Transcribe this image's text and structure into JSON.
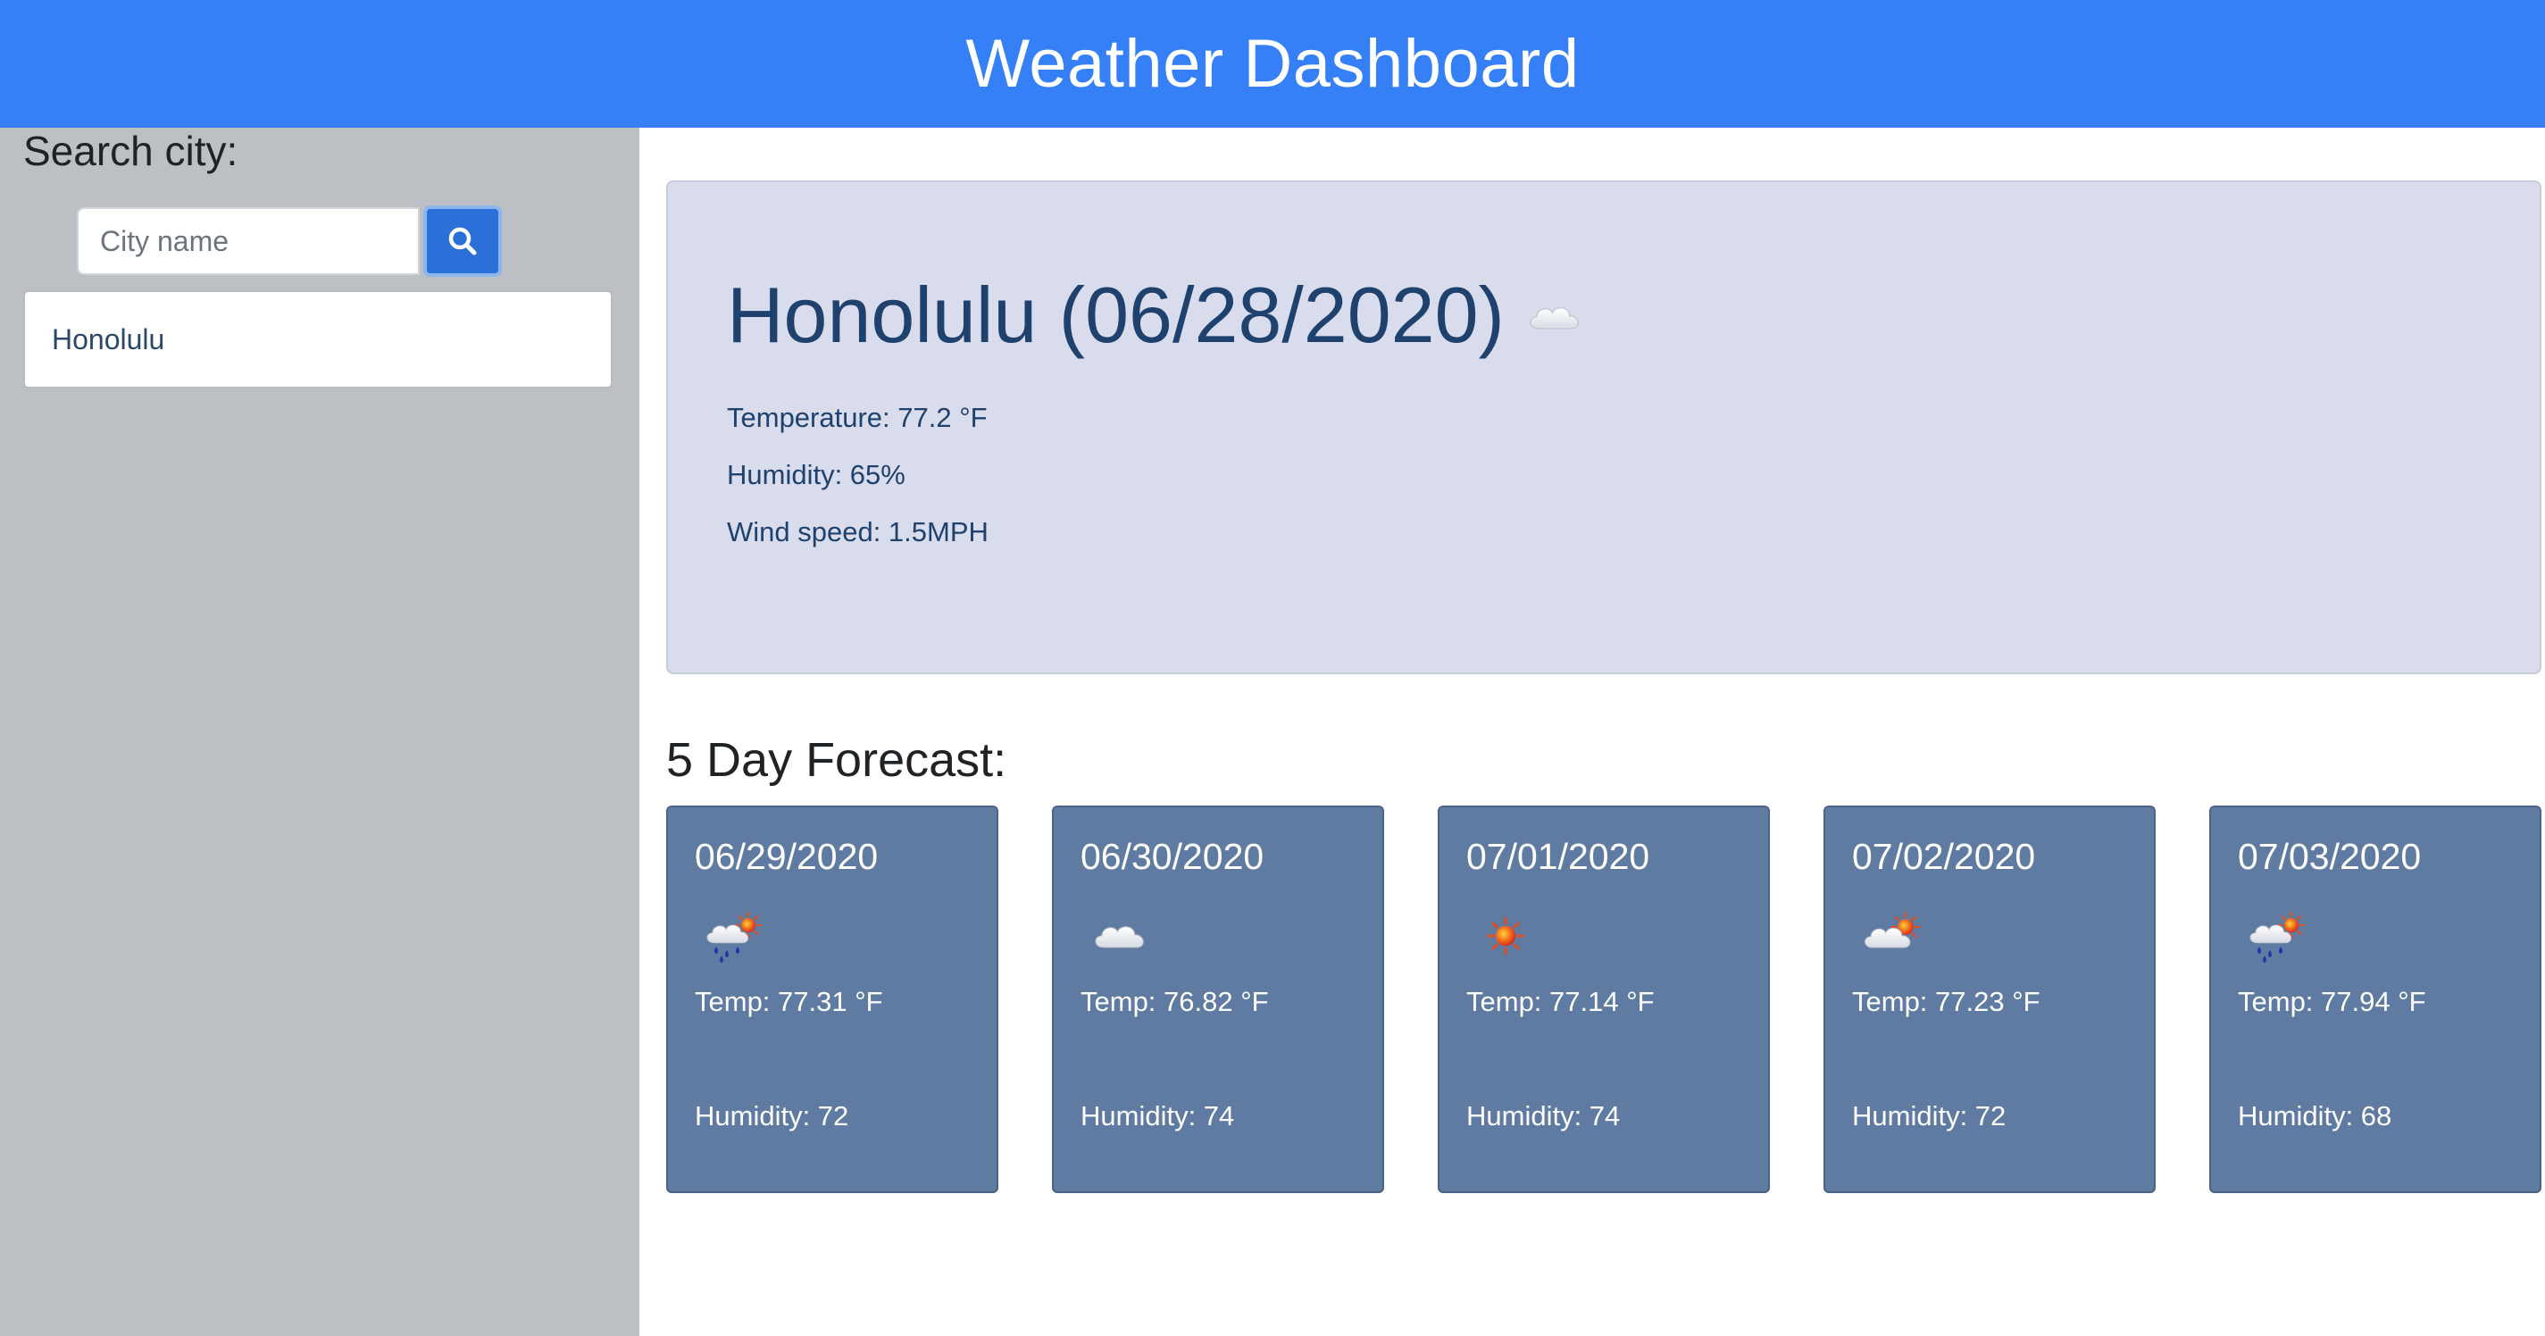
{
  "header": {
    "title": "Weather Dashboard"
  },
  "sidebar": {
    "heading": "Search city:",
    "search": {
      "placeholder": "City name",
      "value": "",
      "button_icon": "search-icon"
    },
    "history": [
      {
        "label": "Honolulu"
      }
    ]
  },
  "current": {
    "title": "Honolulu (06/28/2020)",
    "icon": "cloud-icon",
    "temperature": "Temperature: 77.2 °F",
    "humidity": "Humidity: 65%",
    "wind": "Wind speed: 1.5MPH"
  },
  "forecast": {
    "heading": "5 Day Forecast:",
    "days": [
      {
        "date": "06/29/2020",
        "icon": "rain-sun-icon",
        "temp": "Temp: 77.31 °F",
        "humidity": "Humidity: 72"
      },
      {
        "date": "06/30/2020",
        "icon": "cloud-icon",
        "temp": "Temp: 76.82 °F",
        "humidity": "Humidity: 74"
      },
      {
        "date": "07/01/2020",
        "icon": "sun-icon",
        "temp": "Temp: 77.14 °F",
        "humidity": "Humidity: 74"
      },
      {
        "date": "07/02/2020",
        "icon": "cloud-sun-icon",
        "temp": "Temp: 77.23 °F",
        "humidity": "Humidity: 72"
      },
      {
        "date": "07/03/2020",
        "icon": "rain-sun-icon",
        "temp": "Temp: 77.94 °F",
        "humidity": "Humidity: 68"
      }
    ]
  },
  "colors": {
    "navbar": "#3580f7",
    "sidebar": "#bcbfc4",
    "current_card": "#d8dcec",
    "forecast_card": "#5f7ba1",
    "search_button": "#2b6fd8"
  }
}
